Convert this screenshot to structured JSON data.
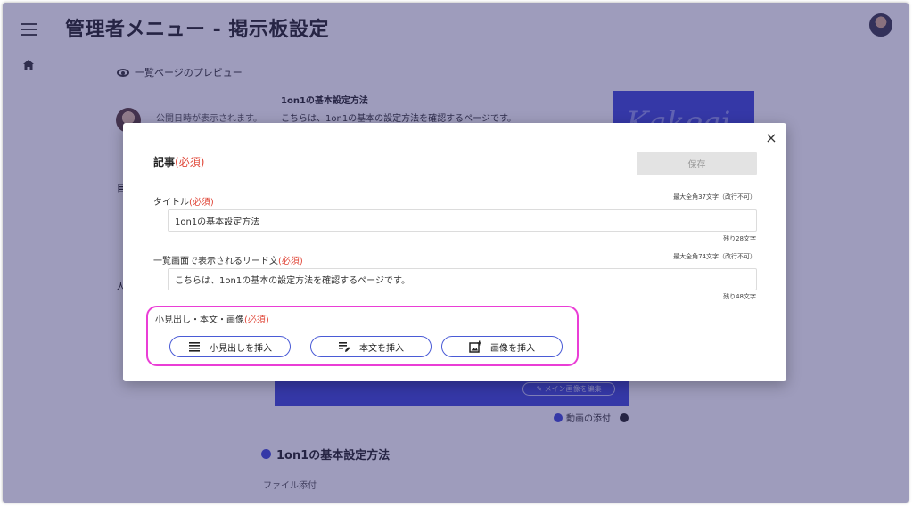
{
  "header": {
    "title": "管理者メニュー - 掲示板設定"
  },
  "preview": {
    "label": "一覧ページのプレビュー",
    "date_text": "公開日時が表示されます。",
    "post_title": "1on1の基本設定方法",
    "lead_text": "こちらは、1on1の基本の設定方法を確認するページです。",
    "image_logo_text": "Kakeai"
  },
  "background": {
    "left_char_1": "目",
    "left_char_2": "人",
    "edit_main_image": "✎ メイン画像を編集",
    "video_attach": "動画の添付",
    "section_title": "1on1の基本設定方法",
    "file_attach": "ファイル添付"
  },
  "modal": {
    "heading": "記事",
    "required": "(必須)",
    "save_label": "保存",
    "close_symbol": "×",
    "title_field": {
      "label": "タイトル",
      "required": "(必須)",
      "hint": "最大全角37文字（改行不可）",
      "value": "1on1の基本設定方法",
      "remaining": "残り28文字"
    },
    "lead_field": {
      "label": "一覧画面で表示されるリード文",
      "required": "(必須)",
      "hint": "最大全角74文字（改行不可）",
      "value": "こちらは、1on1の基本の設定方法を確認するページです。",
      "remaining": "残り48文字"
    },
    "body_section": {
      "label": "小見出し・本文・画像",
      "required": "(必須)",
      "buttons": [
        {
          "label": "小見出しを挿入",
          "icon": "heading-list-icon"
        },
        {
          "label": "本文を挿入",
          "icon": "edit-text-icon"
        },
        {
          "label": "画像を挿入",
          "icon": "add-image-icon"
        }
      ]
    }
  },
  "colors": {
    "overlay": "#2c286e",
    "accent_blue": "#3d46d8",
    "required_red": "#e0483a",
    "highlight_magenta": "#ea3ed6"
  }
}
